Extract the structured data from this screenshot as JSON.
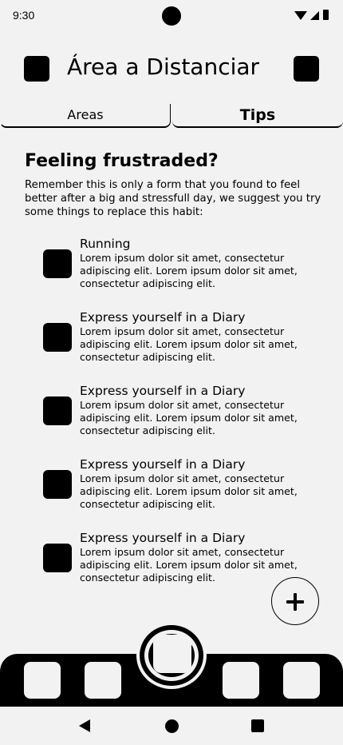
{
  "status_bar": {
    "time": "9:30"
  },
  "header": {
    "title": "Área a Distanciar"
  },
  "tabs": [
    {
      "label": "Areas",
      "active": false
    },
    {
      "label": "Tips",
      "active": true
    }
  ],
  "section": {
    "title": "Feeling frustraded?",
    "intro": "Remember this is only a form that you found to feel better after a big and stressfull day, we suggest you try some things to replace this habit:"
  },
  "tips": [
    {
      "title": "Running",
      "description": "Lorem ipsum dolor sit amet, consectetur adipiscing elit. Lorem ipsum dolor sit amet, consectetur adipiscing elit."
    },
    {
      "title": "Express yourself in a Diary",
      "description": "Lorem ipsum dolor sit amet, consectetur adipiscing elit. Lorem ipsum dolor sit amet, consectetur adipiscing elit."
    },
    {
      "title": "Express yourself in a Diary",
      "description": "Lorem ipsum dolor sit amet, consectetur adipiscing elit. Lorem ipsum dolor sit amet, consectetur adipiscing elit."
    },
    {
      "title": "Express yourself in a Diary",
      "description": "Lorem ipsum dolor sit amet, consectetur adipiscing elit. Lorem ipsum dolor sit amet, consectetur adipiscing elit."
    },
    {
      "title": "Express yourself in a Diary",
      "description": "Lorem ipsum dolor sit amet, consectetur adipiscing elit. Lorem ipsum dolor sit amet, consectetur adipiscing elit."
    }
  ],
  "fab": {
    "icon": "plus-icon"
  },
  "bottom_nav": {
    "items": [
      "nav-tile-1",
      "nav-tile-2",
      "center-action",
      "nav-tile-3",
      "nav-tile-4"
    ]
  },
  "system_nav": {
    "icons": [
      "back-icon",
      "home-icon",
      "recents-icon"
    ]
  },
  "colors": {
    "background": "#f2f2f2",
    "foreground": "#000000"
  }
}
